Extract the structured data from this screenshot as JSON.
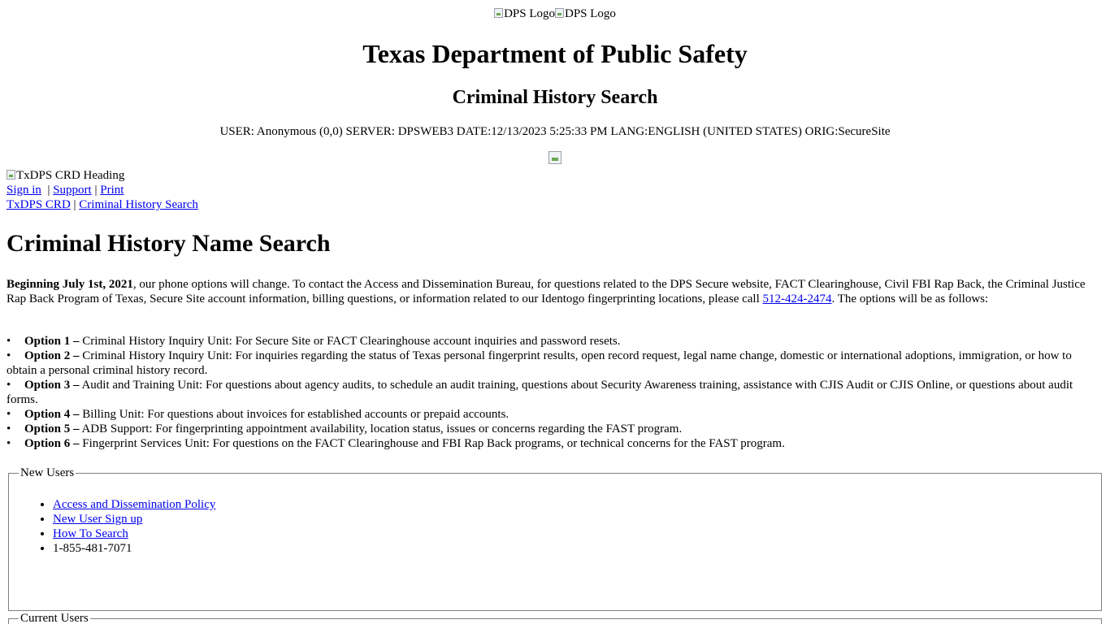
{
  "header": {
    "logo_alt_1": "DPS Logo",
    "logo_alt_2": "DPS Logo",
    "title": "Texas Department of Public Safety",
    "subtitle": "Criminal History Search",
    "status_line": "USER: Anonymous (0,0) SERVER: DPSWEB3 DATE:12/13/2023 5:25:33 PM LANG:ENGLISH (UNITED STATES) ORIG:SecureSite"
  },
  "crd_heading_alt": "TxDPS CRD Heading",
  "nav": {
    "sign_in": "Sign in",
    "sep1": " | ",
    "support": "Support",
    "sep2": " | ",
    "print": "Print"
  },
  "breadcrumb": {
    "home": "TxDPS CRD",
    "sep": " | ",
    "current": "Criminal History Search"
  },
  "main": {
    "heading": "Criminal History Name Search",
    "intro_bold": "Beginning July 1st, 2021",
    "intro_text": ", our phone options will change. To contact the Access and Dissemination Bureau, for questions related to the DPS Secure website, FACT Clearinghouse, Civil FBI Rap Back, the Criminal Justice Rap Back Program of Texas, Secure Site account information, billing questions, or information related to our Identogo fingerprinting locations, please call ",
    "phone_link": "512-424-2474",
    "intro_tail": ". The options will be as follows:",
    "options": [
      {
        "label": "Option 1 –",
        "text": " Criminal History Inquiry Unit: For Secure Site or FACT Clearinghouse account inquiries and password resets."
      },
      {
        "label": "Option 2 –",
        "text": " Criminal History Inquiry Unit: For inquiries regarding the status of Texas personal fingerprint results, open record request, legal name change, domestic or international adoptions, immigration, or how to obtain a personal criminal history record."
      },
      {
        "label": "Option 3 –",
        "text": " Audit and Training Unit: For questions about agency audits, to schedule an audit training, questions about Security Awareness training, assistance with CJIS Audit or CJIS Online, or questions about audit forms."
      },
      {
        "label": "Option 4 –",
        "text": " Billing Unit: For questions about invoices for established accounts or prepaid accounts."
      },
      {
        "label": "Option 5 –",
        "text": " ADB Support: For fingerprinting appointment availability, location status, issues or concerns regarding the FAST program."
      },
      {
        "label": "Option 6 –",
        "text": " Fingerprint Services Unit: For questions on the FACT Clearinghouse and FBI Rap Back programs, or technical concerns for the FAST program."
      }
    ]
  },
  "new_users": {
    "legend": "New Users",
    "links": [
      "Access and Dissemination Policy",
      "New User Sign up",
      "How To Search"
    ],
    "phone": "1-855-481-7071"
  },
  "current_users": {
    "legend": "Current Users"
  },
  "colors": {
    "link": "#0000ee",
    "text": "#000000",
    "border": "#808080"
  }
}
